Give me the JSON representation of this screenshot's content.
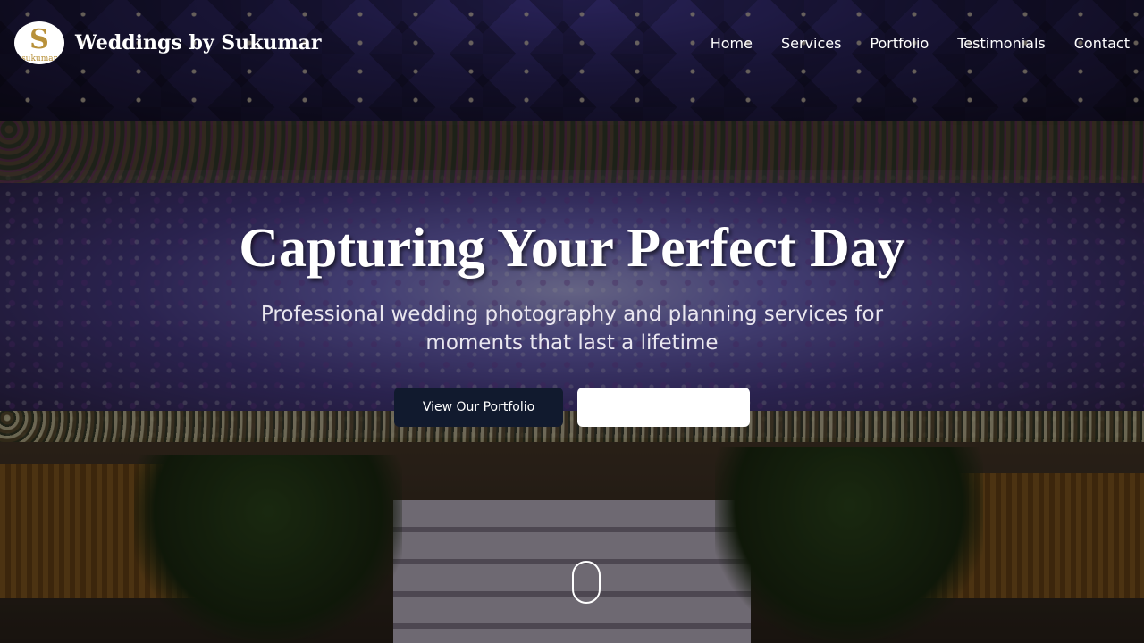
{
  "header": {
    "site_title": "Weddings by Sukumar",
    "logo": {
      "mark": "S",
      "sub": "sukumar"
    },
    "nav": [
      {
        "label": "Home"
      },
      {
        "label": "Services"
      },
      {
        "label": "Portfolio"
      },
      {
        "label": "Testimonials"
      },
      {
        "label": "Contact"
      }
    ]
  },
  "hero": {
    "title": "Capturing Your Perfect Day",
    "subtitle": "Professional wedding photography and planning services for moments that last a lifetime",
    "primary_button": "View Our Portfolio",
    "secondary_button": ""
  },
  "colors": {
    "primary_button_bg": "#111a2e",
    "secondary_button_bg": "#ffffff",
    "text": "#ffffff",
    "logo_gold": "#b8913a"
  },
  "icons": {
    "scroll": "scroll-mouse-icon"
  }
}
